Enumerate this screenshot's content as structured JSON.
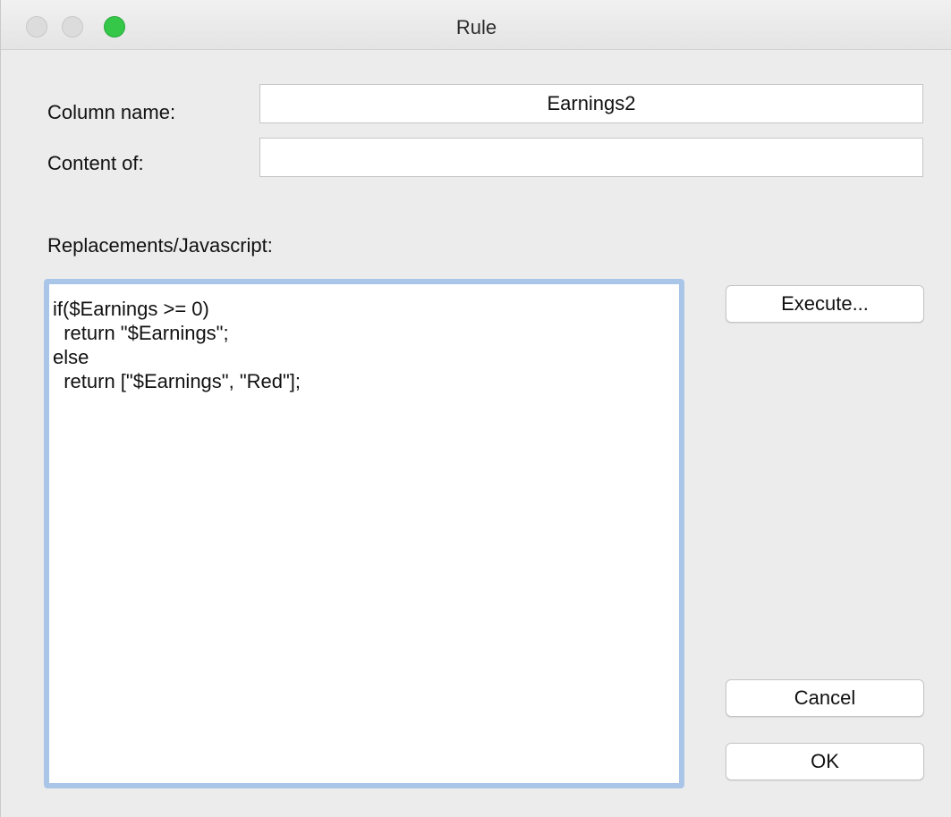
{
  "window": {
    "title": "Rule"
  },
  "form": {
    "column_name_label": "Column name:",
    "column_name_value": "Earnings2",
    "content_of_label": "Content of:",
    "content_of_value": "",
    "replacements_label": "Replacements/Javascript:",
    "script_value": "if($Earnings >= 0)\n  return \"$Earnings\";\nelse\n  return [\"$Earnings\", \"Red\"];"
  },
  "buttons": {
    "execute_label": "Execute...",
    "cancel_label": "Cancel",
    "ok_label": "OK"
  },
  "colors": {
    "zoom_button": "#34c748",
    "focus_ring": "#a9c6e8",
    "window_background": "#ececec"
  }
}
